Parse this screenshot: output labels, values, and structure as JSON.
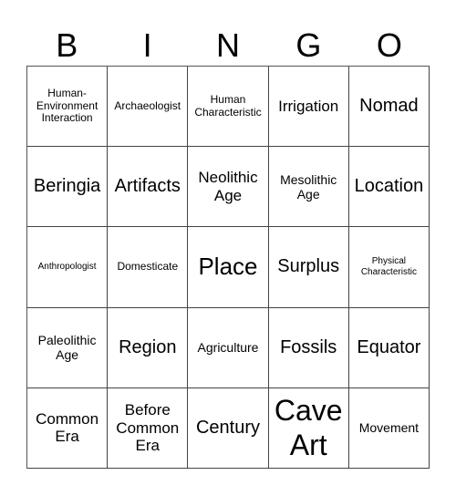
{
  "header": {
    "letters": [
      "B",
      "I",
      "N",
      "G",
      "O"
    ]
  },
  "cells": [
    "Human-\nEnvironment\nInteraction",
    "Archaeologist",
    "Human\nCharacteristic",
    "Irrigation",
    "Nomad",
    "Beringia",
    "Artifacts",
    "Neolithic\nAge",
    "Mesolithic\nAge",
    "Location",
    "Anthropologist",
    "Domesticate",
    "Place",
    "Surplus",
    "Physical\nCharacteristic",
    "Paleolithic\nAge",
    "Region",
    "Agriculture",
    "Fossils",
    "Equator",
    "Common\nEra",
    "Before\nCommon\nEra",
    "Century",
    "Cave\nArt",
    "Movement"
  ]
}
